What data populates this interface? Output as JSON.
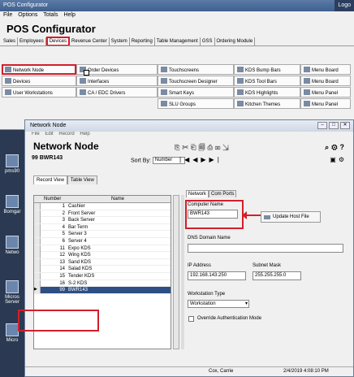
{
  "main": {
    "title": "POS Configurator",
    "logo_label": "Logo",
    "menu": [
      "File",
      "Options",
      "Totals",
      "Help"
    ],
    "app_title": "POS Configurator",
    "module_tabs": [
      "Sales",
      "Employees",
      "Devices",
      "Revenue Center",
      "System",
      "Reporting",
      "Table Management",
      "GSS",
      "Ordering Module"
    ],
    "active_tab": "Devices",
    "buttons": [
      [
        "Network Node",
        "Order Devices",
        "Touchscreens",
        "KDS Bump Bars",
        "Menu Board"
      ],
      [
        "Devices",
        "Interfaces",
        "Touchscreen Designer",
        "KDS Tool Bars",
        "Menu Board"
      ],
      [
        "User Workstations",
        "CA / EDC Drivers",
        "Smart Keys",
        "KDS Highlights",
        "Menu Panel"
      ],
      [
        "",
        "",
        "SLU Groups",
        "Kitchen Themes",
        "Menu Panel"
      ]
    ]
  },
  "desktop_icons": [
    "pms90",
    "Bomgar",
    "Netwo",
    "Micros Server",
    "Micro"
  ],
  "dialog": {
    "title": "Network Node",
    "menu": [
      "File",
      "Edit",
      "Record",
      "Help"
    ],
    "heading": "Network Node",
    "record_label": "99 BWR143",
    "sort_label": "Sort By:",
    "sort_value": "Number",
    "view_tabs": [
      "Record View",
      "Table View"
    ],
    "grid_headers": {
      "number": "Number",
      "name": "Name"
    },
    "rows": [
      {
        "num": "1",
        "name": "Cashier"
      },
      {
        "num": "2",
        "name": "Front Server"
      },
      {
        "num": "3",
        "name": "Back Server"
      },
      {
        "num": "4",
        "name": "Bar Term"
      },
      {
        "num": "5",
        "name": "Server 3"
      },
      {
        "num": "6",
        "name": "Server 4"
      },
      {
        "num": "11",
        "name": "Expo KDS"
      },
      {
        "num": "12",
        "name": "Wing KDS"
      },
      {
        "num": "13",
        "name": "Sand KDS"
      },
      {
        "num": "14",
        "name": "Salad KDS"
      },
      {
        "num": "15",
        "name": "Tender KDS"
      },
      {
        "num": "16",
        "name": "S-2 KDS"
      },
      {
        "num": "99",
        "name": "BWR143"
      }
    ],
    "selected_index": 12,
    "right_tabs": [
      "Network",
      "Com Ports"
    ],
    "computer_name_label": "Computer Name",
    "computer_name_value": "BWR143",
    "update_host_label": "Update Host File",
    "dns_label": "DNS Domain Name",
    "dns_value": "",
    "ip_label": "IP Address",
    "ip_value": "192.168.143.250",
    "subnet_label": "Subnet Mask",
    "subnet_value": "255.255.255.0",
    "ws_type_label": "Workstation Type",
    "ws_type_value": "Workstation",
    "override_label": "Override Authentication Mode",
    "status_user": "Cox, Carrie",
    "status_time": "2/4/2019 4:08:10 PM"
  }
}
